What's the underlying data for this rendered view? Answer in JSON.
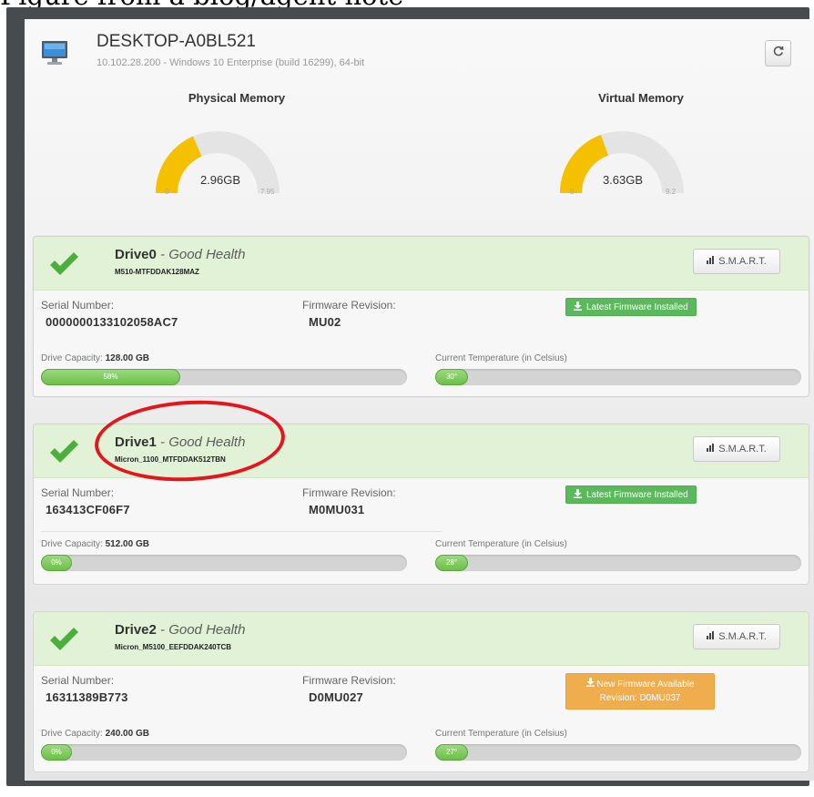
{
  "top_strip": {
    "text": "Figure from a blog/agent note"
  },
  "colors": {
    "accent_green": "#5cb85c",
    "warning_orange": "#f0ad4e",
    "gauge_yellow": "#f5c000",
    "annotation_red": "#e3161c"
  },
  "header": {
    "hostname": "DESKTOP-A0BL521",
    "subinfo": "10.102.28.200 - Windows 10 Enterprise (build 16299), 64-bit",
    "refresh_icon": "refresh-icon",
    "computer_icon": "monitor-icon"
  },
  "gauges": [
    {
      "title": "Physical Memory",
      "value_label": "2.96GB",
      "min_label": "0",
      "max_label": "7.95",
      "fraction": 0.37
    },
    {
      "title": "Virtual Memory",
      "value_label": "3.63GB",
      "min_label": "0",
      "max_label": "9.2",
      "fraction": 0.39
    }
  ],
  "labels": {
    "serial": "Serial Number:",
    "firmware": "Firmware Revision:",
    "capacity": "Drive Capacity:",
    "temperature": "Current Temperature (in Celsius)",
    "smart": "S.M.A.R.T."
  },
  "drives": [
    {
      "name": "Drive0",
      "health": " - Good Health",
      "model": "M510-MTFDDAK128MAZ",
      "serial": "0000000133102058AC7",
      "firmware": "MU02",
      "firmware_status": "Latest Firmware Installed",
      "firmware_status_type": "success",
      "capacity": "128.00 GB",
      "usage_label": "58%",
      "usage_fraction": 0.38,
      "temperature_label": "30°",
      "temperature_fraction": 0.09
    },
    {
      "name": "Drive1",
      "health": " - Good Health",
      "model": "Micron_1100_MTFDDAK512TBN",
      "serial": "163413CF06F7",
      "firmware": "M0MU031",
      "firmware_status": "Latest Firmware Installed",
      "firmware_status_type": "success",
      "capacity": "512.00 GB",
      "usage_label": "0%",
      "usage_fraction": 0.0,
      "temperature_label": "28°",
      "temperature_fraction": 0.09
    },
    {
      "name": "Drive2",
      "health": " - Good Health",
      "model": "Micron_M5100_EEFDDAK240TCB",
      "serial": "16311389B773",
      "firmware": "D0MU027",
      "firmware_status": "New Firmware Available",
      "firmware_status_line2": "Revision: D0MU037",
      "firmware_status_type": "warning",
      "capacity": "240.00 GB",
      "usage_label": "0%",
      "usage_fraction": 0.0,
      "temperature_label": "27°",
      "temperature_fraction": 0.09
    }
  ]
}
